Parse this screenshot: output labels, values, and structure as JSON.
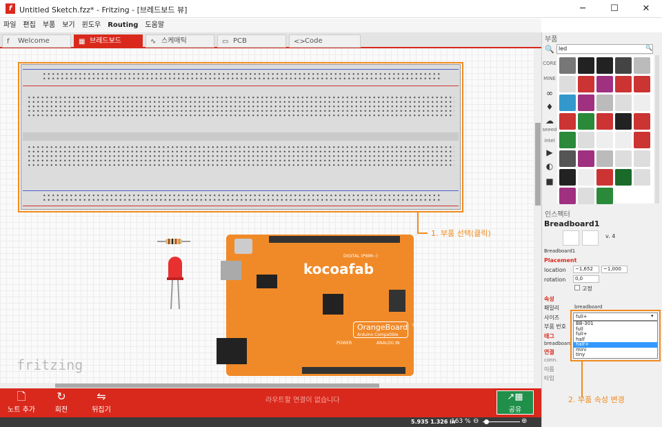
{
  "window": {
    "title": "Untitled Sketch.fzz* - Fritzing - [브레드보드 뷰]",
    "minimize": "─",
    "maximize": "☐",
    "close": "✕"
  },
  "menu": [
    "파일",
    "편집",
    "부품",
    "보기",
    "윈도우",
    "Routing",
    "도움말"
  ],
  "tabs": [
    {
      "label": "Welcome",
      "icon": "f"
    },
    {
      "label": "브레드보드",
      "icon": "▦"
    },
    {
      "label": "스케매틱",
      "icon": "∿"
    },
    {
      "label": "PCB",
      "icon": "▭"
    },
    {
      "label": "Code",
      "icon": "<>"
    }
  ],
  "canvas": {
    "logo": "fritzing"
  },
  "callouts": {
    "one": "1. 부품 선택(클릭)",
    "two": "2. 부품 속성 변경"
  },
  "toolbar": {
    "add_note": "노트 추가",
    "rotate": "회전",
    "flip": "뒤집기",
    "routing_msg": "라우트할 연결이 없습니다",
    "share": "공유"
  },
  "status": {
    "coords": "5.935 1.326 in",
    "zoom": "163 %"
  },
  "parts_panel": {
    "title": "부품",
    "search_value": "led",
    "bins": [
      "CORE",
      "MINE",
      "∞",
      "♦",
      "☁",
      "seeed",
      "intel",
      "▶",
      "◐",
      "■"
    ]
  },
  "inspector": {
    "title": "인스펙터",
    "part_name": "Breadboard1",
    "version": "v. 4",
    "thumb_label": "Breadboard1",
    "placement": "Placement",
    "location_label": "location",
    "location_x": "~1,652",
    "location_y": "~1,000",
    "rotation_label": "rotation",
    "rotation_value": "0,0",
    "lock_label": "고정",
    "props_section": "속성",
    "family_label": "패밀리",
    "family_value": "breadboard",
    "size_label": "사이즈",
    "size_value": "full+",
    "part_no_label": "부품 번호",
    "tags_section": "태그",
    "tags_value": "breadboard",
    "conn_section": "연결",
    "conn_label": "conn.",
    "name_label": "이름",
    "type_label": "타입",
    "size_options": [
      "BB-301",
      "full",
      "full+",
      "half",
      "half+",
      "mini",
      "tiny"
    ],
    "selected_option": "half+"
  },
  "arduino": {
    "brand": "kocoafab",
    "board": "OrangeBoard",
    "sub": "Arduino Compatible",
    "digital": "DIGITAL (PWM~)",
    "analog": "ANALOG IN",
    "power": "POWER",
    "isp": "ISP"
  }
}
